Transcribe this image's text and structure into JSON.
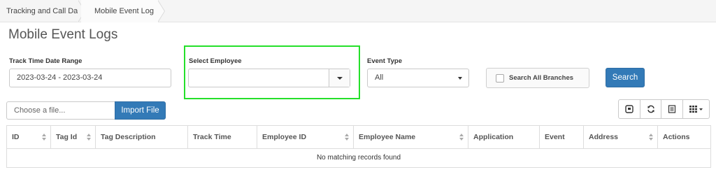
{
  "breadcrumb": {
    "items": [
      "Tracking and Call Data",
      "Mobile Event Log"
    ]
  },
  "page": {
    "title": "Mobile Event Logs"
  },
  "filters": {
    "date_range": {
      "label": "Track Time Date Range",
      "value": "2023-03-24 - 2023-03-24"
    },
    "employee": {
      "label": "Select Employee",
      "value": ""
    },
    "event_type": {
      "label": "Event Type",
      "value": "All"
    },
    "search_all_branches": {
      "label": "Search All Branches",
      "checked": false
    },
    "search_button": "Search"
  },
  "import": {
    "placeholder": "Choose a file...",
    "button": "Import File"
  },
  "toolbar": {
    "icons": [
      "toggle-icon",
      "refresh-icon",
      "export-list-icon",
      "columns-grid-icon"
    ]
  },
  "table": {
    "columns": [
      "ID",
      "Tag Id",
      "Tag Description",
      "Track Time",
      "Employee ID",
      "Employee Name",
      "Application",
      "Event",
      "Address",
      "Actions"
    ],
    "empty_message": "No matching records found"
  },
  "colors": {
    "primary": "#337ab7",
    "highlight": "#25e02a"
  }
}
